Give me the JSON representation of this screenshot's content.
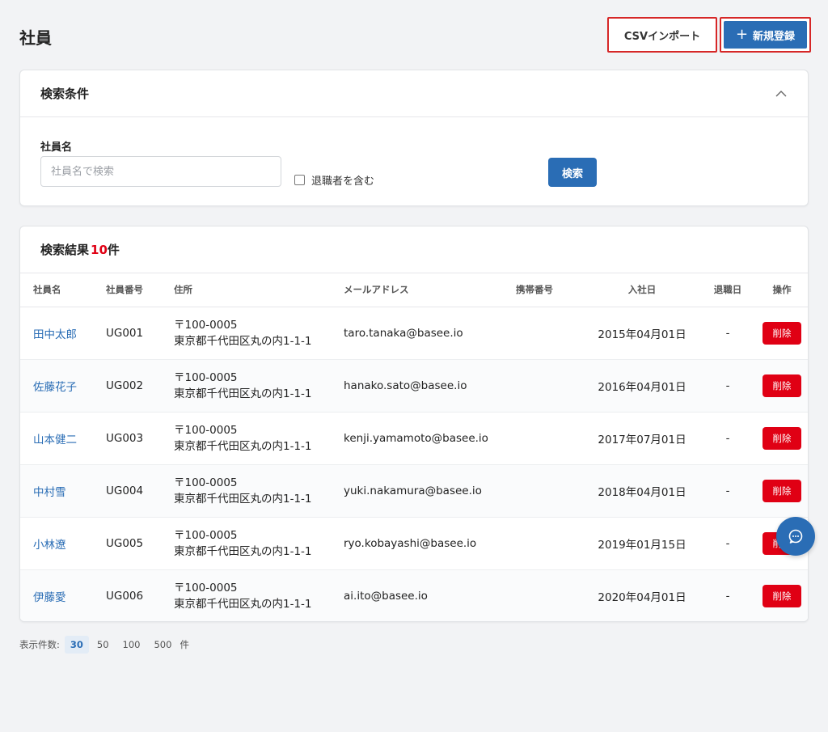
{
  "page": {
    "title": "社員"
  },
  "header": {
    "csv_import_label": "CSVインポート",
    "new_label": "新規登録",
    "new_icon": "plus-icon"
  },
  "search": {
    "title": "検索条件",
    "collapse_icon": "chevron-up-icon",
    "name_label": "社員名",
    "name_placeholder": "社員名で検索",
    "name_value": "",
    "include_retired_label": "退職者を含む",
    "include_retired_checked": false,
    "search_button": "検索"
  },
  "results": {
    "title": "検索結果",
    "count": "10",
    "count_unit": "件",
    "columns": [
      "社員名",
      "社員番号",
      "住所",
      "メールアドレス",
      "携帯番号",
      "入社日",
      "退職日",
      "操作"
    ],
    "rows": [
      {
        "name": "田中太郎",
        "id": "UG001",
        "zip": "〒100-0005",
        "address": "東京都千代田区丸の内1-1-1",
        "email": "taro.tanaka@basee.io",
        "mobile": "",
        "joined": "2015年04月01日",
        "retired": "-",
        "action": "削除"
      },
      {
        "name": "佐藤花子",
        "id": "UG002",
        "zip": "〒100-0005",
        "address": "東京都千代田区丸の内1-1-1",
        "email": "hanako.sato@basee.io",
        "mobile": "",
        "joined": "2016年04月01日",
        "retired": "-",
        "action": "削除"
      },
      {
        "name": "山本健二",
        "id": "UG003",
        "zip": "〒100-0005",
        "address": "東京都千代田区丸の内1-1-1",
        "email": "kenji.yamamoto@basee.io",
        "mobile": "",
        "joined": "2017年07月01日",
        "retired": "-",
        "action": "削除"
      },
      {
        "name": "中村雪",
        "id": "UG004",
        "zip": "〒100-0005",
        "address": "東京都千代田区丸の内1-1-1",
        "email": "yuki.nakamura@basee.io",
        "mobile": "",
        "joined": "2018年04月01日",
        "retired": "-",
        "action": "削除"
      },
      {
        "name": "小林遼",
        "id": "UG005",
        "zip": "〒100-0005",
        "address": "東京都千代田区丸の内1-1-1",
        "email": "ryo.kobayashi@basee.io",
        "mobile": "",
        "joined": "2019年01月15日",
        "retired": "-",
        "action": "削除"
      },
      {
        "name": "伊藤愛",
        "id": "UG006",
        "zip": "〒100-0005",
        "address": "東京都千代田区丸の内1-1-1",
        "email": "ai.ito@basee.io",
        "mobile": "",
        "joined": "2020年04月01日",
        "retired": "-",
        "action": "削除"
      }
    ]
  },
  "pager": {
    "label": "表示件数:",
    "options": [
      "30",
      "50",
      "100",
      "500"
    ],
    "selected": "30",
    "unit": "件"
  },
  "chat": {
    "icon": "chat-bubble-icon"
  },
  "colors": {
    "primary": "#2a6db5",
    "danger": "#e00014",
    "highlight_border": "#d62727",
    "background": "#f2f3f5"
  }
}
